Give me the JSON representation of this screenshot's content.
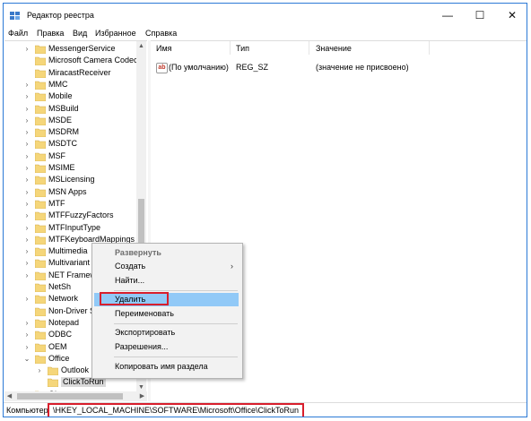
{
  "window": {
    "title": "Редактор реестра",
    "controls": {
      "minimize": "—",
      "maximize": "☐",
      "close": "✕"
    }
  },
  "menu": [
    "Файл",
    "Правка",
    "Вид",
    "Избранное",
    "Справка"
  ],
  "tree": {
    "items": [
      {
        "label": "MessengerService",
        "expandable": true
      },
      {
        "label": "Microsoft Camera Codec",
        "expandable": false
      },
      {
        "label": "MiracastReceiver",
        "expandable": false
      },
      {
        "label": "MMC",
        "expandable": true
      },
      {
        "label": "Mobile",
        "expandable": true
      },
      {
        "label": "MSBuild",
        "expandable": true
      },
      {
        "label": "MSDE",
        "expandable": true
      },
      {
        "label": "MSDRM",
        "expandable": true
      },
      {
        "label": "MSDTC",
        "expandable": true
      },
      {
        "label": "MSF",
        "expandable": true
      },
      {
        "label": "MSIME",
        "expandable": true
      },
      {
        "label": "MSLicensing",
        "expandable": true
      },
      {
        "label": "MSN Apps",
        "expandable": true
      },
      {
        "label": "MTF",
        "expandable": true
      },
      {
        "label": "MTFFuzzyFactors",
        "expandable": true
      },
      {
        "label": "MTFInputType",
        "expandable": true
      },
      {
        "label": "MTFKeyboardMappings",
        "expandable": true
      },
      {
        "label": "Multimedia",
        "expandable": true
      },
      {
        "label": "Multivariant",
        "expandable": true
      },
      {
        "label": "NET Framew",
        "expandable": true
      },
      {
        "label": "NetSh",
        "expandable": false
      },
      {
        "label": "Network",
        "expandable": true
      },
      {
        "label": "Non-Driver S",
        "expandable": false
      },
      {
        "label": "Notepad",
        "expandable": true
      },
      {
        "label": "ODBC",
        "expandable": true
      },
      {
        "label": "OEM",
        "expandable": true
      },
      {
        "label": "Office",
        "expandable": true,
        "expanded": true
      },
      {
        "label": "Outlook",
        "expandable": true,
        "indent": 1
      },
      {
        "label": "ClickToRun",
        "expandable": false,
        "indent": 1,
        "selected": true
      },
      {
        "label": "Ole",
        "expandable": true
      }
    ]
  },
  "list": {
    "headers": {
      "name": "Имя",
      "type": "Тип",
      "value": "Значение"
    },
    "rows": [
      {
        "icon": "string-value-icon",
        "icon_text": "ab",
        "name": "(По умолчанию)",
        "type": "REG_SZ",
        "value": "(значение не присвоено)"
      }
    ]
  },
  "context_menu": {
    "items": {
      "expand": "Развернуть",
      "create": "Создать",
      "find": "Найти...",
      "delete": "Удалить",
      "rename": "Переименовать",
      "export": "Экспортировать",
      "permissions": "Разрешения...",
      "copy_key_name": "Копировать имя раздела"
    },
    "submenu_arrow": "›"
  },
  "status": {
    "prefix": "Компьютер",
    "path": "\\HKEY_LOCAL_MACHINE\\SOFTWARE\\Microsoft\\Office\\ClickToRun"
  },
  "colors": {
    "highlight_box": "#d81e2c",
    "menu_hover": "#91c9f7",
    "folder": "#f5d67a"
  }
}
